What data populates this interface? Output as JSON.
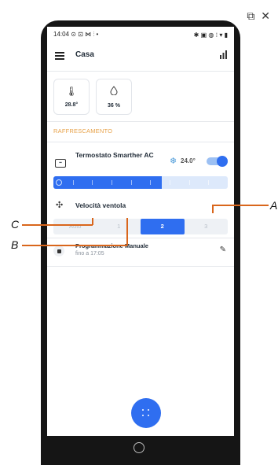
{
  "corner_icons": [
    "external-window-icon",
    "close-icon"
  ],
  "status_bar": {
    "time": "14:04",
    "left_icons": "⊙ ⊡ ⋈ ⫶ •",
    "right_icons": "✱ ▣ ◍ ⁝ ▾ ▮"
  },
  "app_bar": {
    "title": "Casa"
  },
  "sensors": [
    {
      "icon": "thermometer-icon",
      "value": "28.8°"
    },
    {
      "icon": "humidity-drop-icon",
      "value": "36 %"
    }
  ],
  "section_title": "RAFFRESCAMENTO",
  "thermostat": {
    "name": "Termostato Smarther AC",
    "mode_icon": "snowflake-icon",
    "setpoint": "24.0°",
    "enabled": true,
    "setpoint_level": 0.62,
    "accent_color": "#2f6ef0"
  },
  "fan": {
    "label": "Velocità ventola",
    "options": [
      "Auto",
      "1",
      "2",
      "3"
    ],
    "selected": "2"
  },
  "schedule": {
    "title": "Programmazione Manuale",
    "until": "fino a 17:05"
  },
  "callouts": {
    "a": "A",
    "b": "B",
    "c": "C"
  }
}
